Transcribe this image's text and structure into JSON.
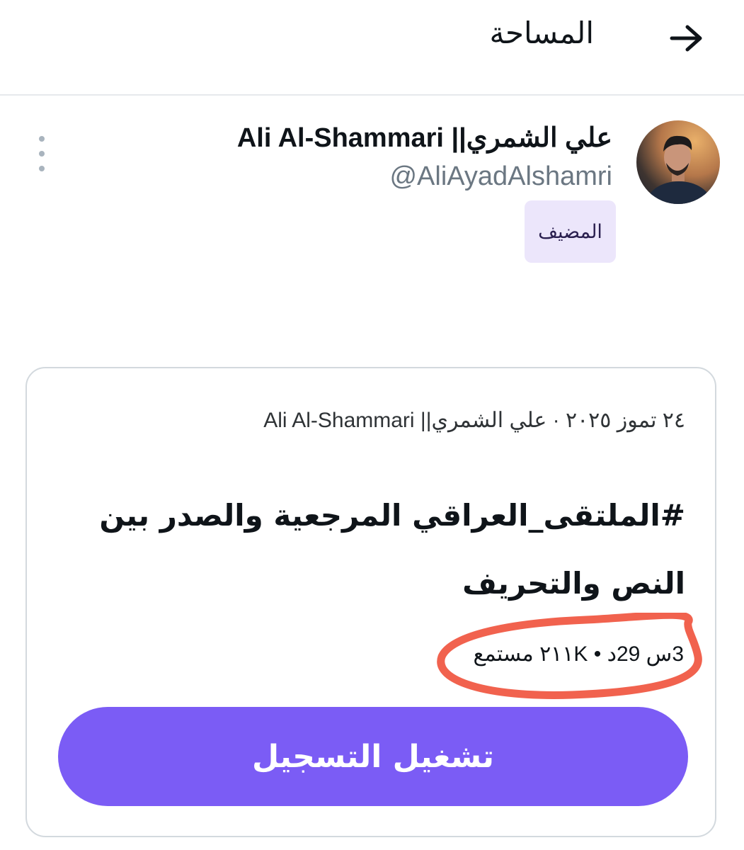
{
  "header": {
    "title": "المساحة",
    "back_icon": "arrow-right-icon"
  },
  "host": {
    "name": "علي الشمري|| Ali Al-Shammari",
    "handle": "@AliAyadAlshamri",
    "role_badge": "المضيف",
    "more_icon": "more-vertical-icon"
  },
  "space_card": {
    "date_and_host": "٢٤ تموز ٢٠٢٥ · علي الشمري|| Ali Al-Shammari",
    "title": "#الملتقى_العراقي المرجعية والصدر بين النص والتحريف",
    "stats": "3س 29د • ٢١١K مستمع",
    "play_button_label": "تشغيل التسجيل"
  },
  "colors": {
    "accent": "#7b5cf5",
    "badge_bg": "#ece6fb",
    "annotation": "#f0553f"
  }
}
